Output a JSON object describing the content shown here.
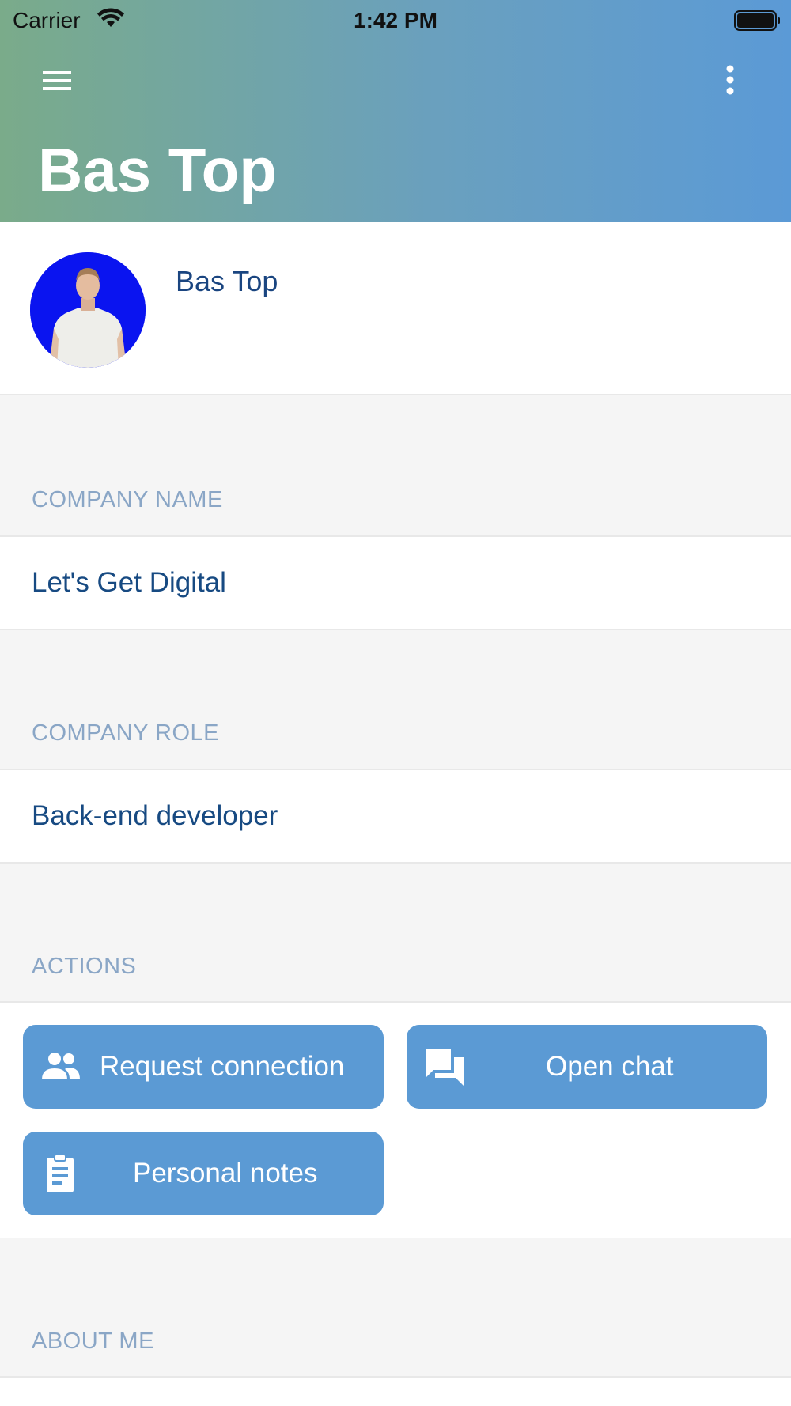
{
  "status_bar": {
    "carrier": "Carrier",
    "time": "1:42 PM"
  },
  "header": {
    "title": "Bas Top",
    "menu_icon": "hamburger-menu-icon",
    "more_icon": "more-vertical-icon"
  },
  "profile": {
    "name": "Bas Top",
    "avatar": "avatar-photo"
  },
  "sections": {
    "company_name": {
      "label": "COMPANY NAME",
      "value": "Let's Get Digital"
    },
    "company_role": {
      "label": "COMPANY ROLE",
      "value": "Back-end developer"
    },
    "actions": {
      "label": "ACTIONS",
      "buttons": [
        {
          "label": "Request connection",
          "icon": "people-icon"
        },
        {
          "label": "Open chat",
          "icon": "chat-icon"
        },
        {
          "label": "Personal notes",
          "icon": "clipboard-icon"
        }
      ]
    },
    "about_me": {
      "label": "ABOUT ME"
    }
  },
  "colors": {
    "header_gradient_start": "#7aab8a",
    "header_gradient_end": "#5b9ad6",
    "button_bg": "#5b9ad4",
    "label_color": "#8aa6c6",
    "value_color": "#174a82"
  }
}
